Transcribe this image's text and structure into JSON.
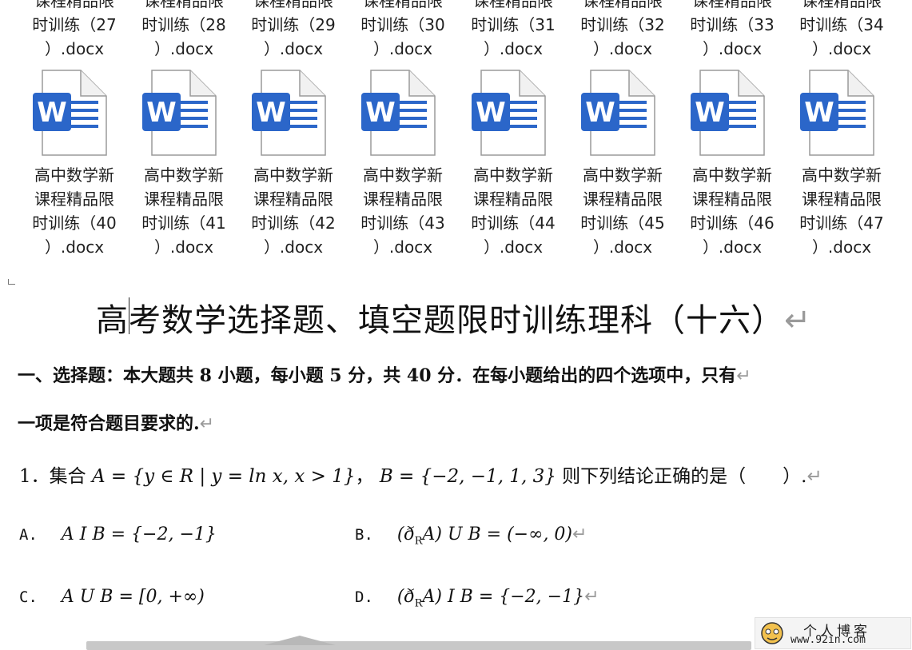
{
  "top_row_labels": [
    {
      "line0": "课程精品限",
      "line1": "时训练（27",
      "line2": "）.docx"
    },
    {
      "line0": "课程精品限",
      "line1": "时训练（28",
      "line2": "）.docx"
    },
    {
      "line0": "课程精品限",
      "line1": "时训练（29",
      "line2": "）.docx"
    },
    {
      "line0": "课程精品限",
      "line1": "时训练（30",
      "line2": "）.docx"
    },
    {
      "line0": "课程精品限",
      "line1": "时训练（31",
      "line2": "）.docx"
    },
    {
      "line0": "课程精品限",
      "line1": "时训练（32",
      "line2": "）.docx"
    },
    {
      "line0": "课程精品限",
      "line1": "时训练（33",
      "line2": "）.docx"
    },
    {
      "line0": "课程精品限",
      "line1": "时训练（34",
      "line2": "）.docx"
    }
  ],
  "files": [
    {
      "line1": "高中数学新",
      "line2": "课程精品限",
      "line3": "时训练（40",
      "line4": "）.docx",
      "icon_letter": "W"
    },
    {
      "line1": "高中数学新",
      "line2": "课程精品限",
      "line3": "时训练（41",
      "line4": "）.docx",
      "icon_letter": "W"
    },
    {
      "line1": "高中数学新",
      "line2": "课程精品限",
      "line3": "时训练（42",
      "line4": "）.docx",
      "icon_letter": "W"
    },
    {
      "line1": "高中数学新",
      "line2": "课程精品限",
      "line3": "时训练（43",
      "line4": "）.docx",
      "icon_letter": "W"
    },
    {
      "line1": "高中数学新",
      "line2": "课程精品限",
      "line3": "时训练（44",
      "line4": "）.docx",
      "icon_letter": "W"
    },
    {
      "line1": "高中数学新",
      "line2": "课程精品限",
      "line3": "时训练（45",
      "line4": "）.docx",
      "icon_letter": "W"
    },
    {
      "line1": "高中数学新",
      "line2": "课程精品限",
      "line3": "时训练（46",
      "line4": "）.docx",
      "icon_letter": "W"
    },
    {
      "line1": "高中数学新",
      "line2": "课程精品限",
      "line3": "时训练（47",
      "line4": "）.docx",
      "icon_letter": "W"
    }
  ],
  "colors": {
    "word_blue": "#2b66c9",
    "page_gray": "#e9e9e9"
  },
  "document": {
    "title": "高考数学选择题、填空题限时训练理科（十六）",
    "section_line1": "一、选择题：本大题共 8 小题，每小题 5 分，共 40 分．在每小题给出的四个选项中，只有",
    "section_line2": "一项是符合题目要求的.",
    "q1_prefix": "1．集合 ",
    "q1_setA": "A = {y ∈ R | y = ln x, x > 1}",
    "q1_sep": "， ",
    "q1_setB": "B = {−2, −1, 1, 3}",
    "q1_suffix": " 则下列结论正确的是（　　）.",
    "optA_label": "A.",
    "optA_expr": "A I  B = {−2, −1}",
    "optB_label": "B.",
    "optB_expr": "(ð",
    "optB_sub": "R",
    "optB_rest": "A) U B = (−∞, 0)",
    "optC_label": "C.",
    "optC_expr": "A U B = [0, +∞)",
    "optD_label": "D.",
    "optD_expr": "(ð",
    "optD_sub": "R",
    "optD_rest": "A) I  B = {−2, −1}",
    "return_mark": "↵"
  },
  "watermark": {
    "line1": "个人博客",
    "line2": "www.92in.com"
  }
}
